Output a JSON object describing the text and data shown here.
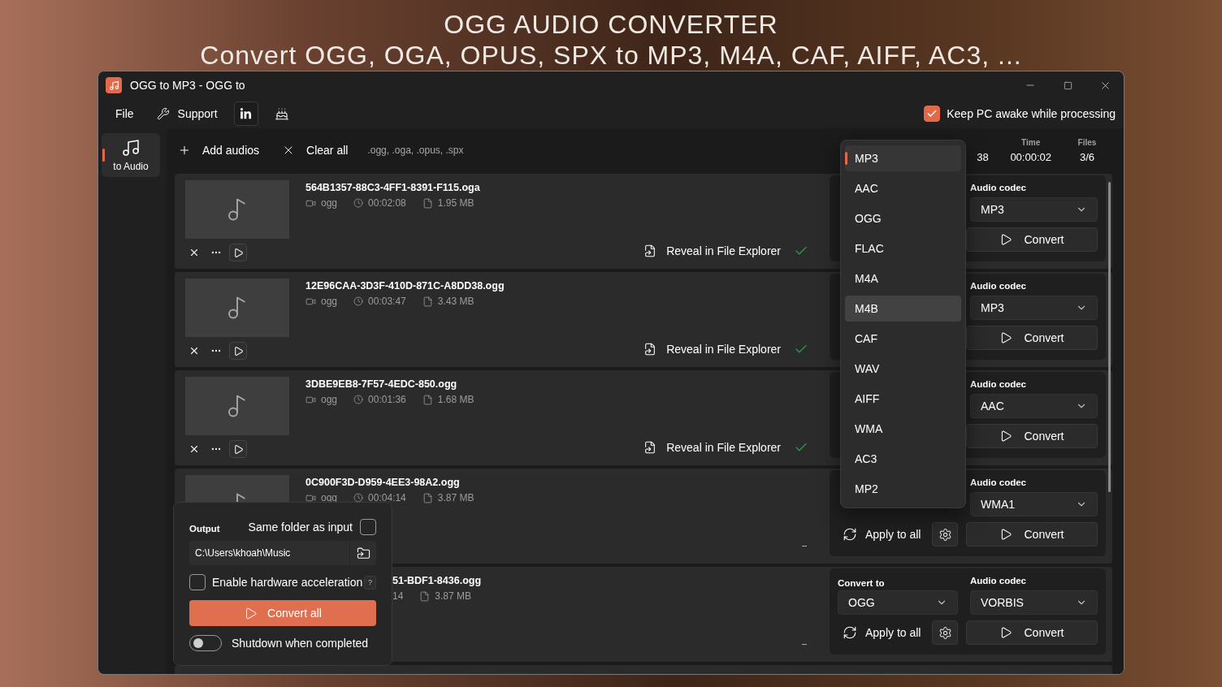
{
  "banner": {
    "title": "OGG AUDIO CONVERTER",
    "subtitle": "Convert OGG, OGA, OPUS, SPX to MP3, M4A, CAF, AIFF, AC3, ..."
  },
  "window": {
    "title": "OGG to MP3 - OGG to"
  },
  "menu": [
    {
      "kind": "text",
      "label": "File"
    },
    {
      "kind": "wrench",
      "label": "Support"
    },
    {
      "kind": "linkedin"
    },
    {
      "kind": "cake"
    }
  ],
  "keep_awake": {
    "label": "Keep PC awake while processing",
    "checked": true
  },
  "nav": [
    {
      "label": "to Audio",
      "selected": true
    }
  ],
  "toolbar": {
    "add": "Add audios",
    "clear": "Clear all",
    "extensions": ".ogg, .oga, .opus, .spx"
  },
  "stats": [
    {
      "value": "38"
    },
    {
      "label": "Time",
      "value": "00:00:02"
    },
    {
      "label": "Files",
      "value": "3/6"
    }
  ],
  "files": [
    {
      "kind": "full",
      "name": "564B1357-88C3-4FF1-8391-F115.oga",
      "format": "ogg",
      "duration": "00:02:08",
      "size": "1.95 MB",
      "converted": true,
      "reveal": "Reveal in File Explorer",
      "codec_label": "Audio codec",
      "codec": "MP3",
      "convert": "Convert"
    },
    {
      "kind": "full",
      "name": "12E96CAA-3D3F-410D-871C-A8DD38.ogg",
      "format": "ogg",
      "duration": "00:03:47",
      "size": "3.43 MB",
      "converted": true,
      "reveal": "Reveal in File Explorer",
      "codec_label": "Audio codec",
      "codec": "MP3",
      "convert": "Convert"
    },
    {
      "kind": "full",
      "name": "3DBE9EB8-7F57-4EDC-850.ogg",
      "format": "ogg",
      "duration": "00:01:36",
      "size": "1.68 MB",
      "converted": true,
      "reveal": "Reveal in File Explorer",
      "codec_label": "Audio codec",
      "codec": "AAC",
      "convert": "Convert"
    },
    {
      "kind": "lower-covered",
      "name": "0C900F3D-D959-4EE3-98A2.ogg",
      "format": "ogg",
      "duration": "00:04:14",
      "size": "3.87 MB",
      "converted": false,
      "codec_label": "Audio codec",
      "codec": "WMA1",
      "apply": "Apply to all",
      "convert": "Convert"
    },
    {
      "kind": "left-covered",
      "name": "51-BDF1-8436.ogg",
      "duration": "14",
      "size": "3.87 MB",
      "converted": false,
      "convert_to_label": "Convert to",
      "convert_to": "OGG",
      "codec_label": "Audio codec",
      "codec": "VORBIS",
      "apply": "Apply to all",
      "convert": "Convert"
    },
    {
      "kind": "cut-off"
    }
  ],
  "formats": {
    "items": [
      {
        "label": "MP3",
        "selected": true,
        "hovered": false
      },
      {
        "label": "AAC",
        "selected": false,
        "hovered": false
      },
      {
        "label": "OGG",
        "selected": false,
        "hovered": false
      },
      {
        "label": "FLAC",
        "selected": false,
        "hovered": false
      },
      {
        "label": "M4A",
        "selected": false,
        "hovered": false
      },
      {
        "label": "M4B",
        "selected": false,
        "hovered": true
      },
      {
        "label": "CAF",
        "selected": false,
        "hovered": false
      },
      {
        "label": "WAV",
        "selected": false,
        "hovered": false
      },
      {
        "label": "AIFF",
        "selected": false,
        "hovered": false
      },
      {
        "label": "WMA",
        "selected": false,
        "hovered": false
      },
      {
        "label": "AC3",
        "selected": false,
        "hovered": false
      },
      {
        "label": "MP2",
        "selected": false,
        "hovered": false
      }
    ]
  },
  "output": {
    "label": "Output",
    "same_folder": {
      "label": "Same folder as input",
      "checked": false
    },
    "path": "C:\\Users\\khoah\\Music",
    "hw_accel": {
      "label": "Enable hardware acceleration",
      "checked": false
    },
    "help": "?",
    "convert_all": "Convert all",
    "shutdown": {
      "label": "Shutdown when completed",
      "on": false
    }
  }
}
